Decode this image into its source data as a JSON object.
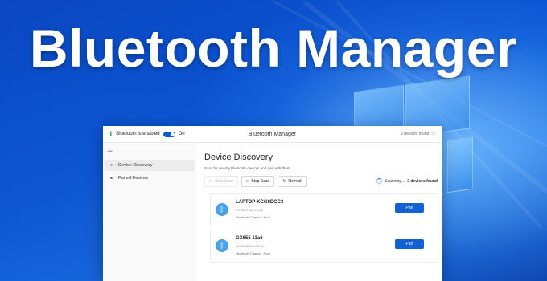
{
  "banner": {
    "headline": "Bluetooth Manager"
  },
  "colors": {
    "accent": "#1160d4",
    "bluetooth_on": "#2ea043",
    "device_icon": "#4aa3ea"
  },
  "titlebar": {
    "bluetooth_status": "Bluetooth is enabled",
    "toggle_state": "On",
    "app_title": "Bluetooth Manager",
    "devices_found": "2 devices found"
  },
  "sidebar": {
    "items": [
      {
        "label": "Device Discovery",
        "icon": "search-icon",
        "active": true
      },
      {
        "label": "Paired Devices",
        "icon": "link-icon",
        "active": false
      }
    ]
  },
  "main": {
    "title": "Device Discovery",
    "subtitle": "Scan for nearby Bluetooth devices and pair with them",
    "toolbar": {
      "start_scan": "Start Scan",
      "stop_scan": "Stop Scan",
      "refresh": "Refresh"
    },
    "status_prefix": "Scanning...",
    "status_count": "2 devices found",
    "devices": [
      {
        "name": "LAPTOP-KCG8DCC3",
        "address": "2C:3B:70:60:74:0A",
        "meta": "Bluetooth Classic · Poor",
        "action": "Pair"
      },
      {
        "name": "GX655 13a6",
        "address": "94:6E:6A:CA:E4:AC",
        "meta": "Bluetooth Classic · Poor",
        "action": "Pair"
      }
    ]
  }
}
